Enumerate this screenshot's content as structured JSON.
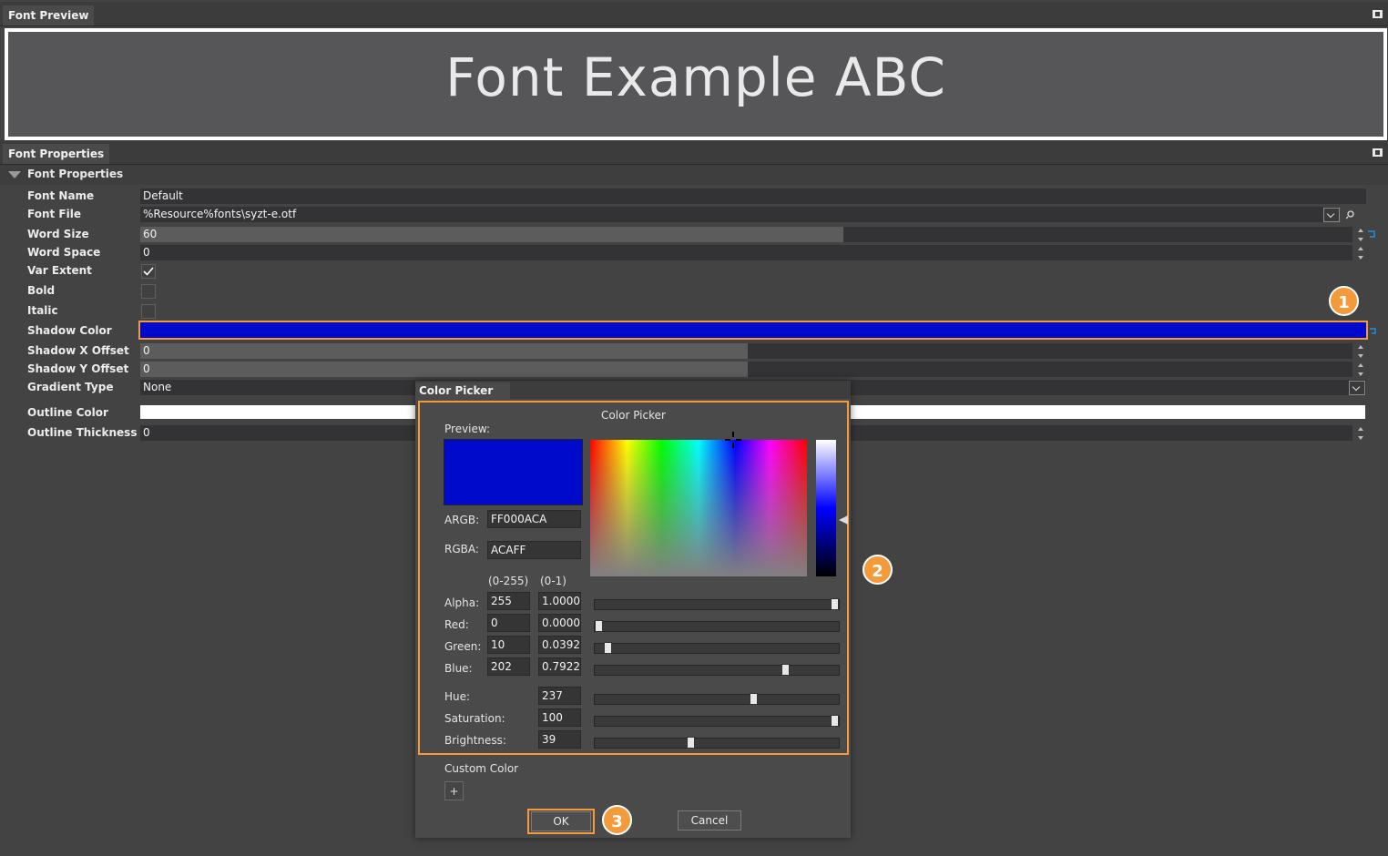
{
  "preview_panel": {
    "title": "Font Preview",
    "sample_text": "Font Example ABC"
  },
  "properties_panel": {
    "title": "Font Properties",
    "section_title": "Font Properties",
    "rows": {
      "font_name": {
        "label": "Font Name",
        "value": "Default"
      },
      "font_file": {
        "label": "Font File",
        "value": "%Resource%fonts\\syzt-e.otf"
      },
      "word_size": {
        "label": "Word Size",
        "value": "60"
      },
      "word_space": {
        "label": "Word Space",
        "value": "0"
      },
      "var_extent": {
        "label": "Var Extent",
        "checked": true
      },
      "bold": {
        "label": "Bold",
        "checked": false
      },
      "italic": {
        "label": "Italic",
        "checked": false
      },
      "shadow_color": {
        "label": "Shadow Color",
        "color": "#000ACA"
      },
      "shadow_x_offset": {
        "label": "Shadow X Offset",
        "value": "0"
      },
      "shadow_y_offset": {
        "label": "Shadow Y Offset",
        "value": "0"
      },
      "gradient_type": {
        "label": "Gradient Type",
        "value": "None"
      },
      "outline_color": {
        "label": "Outline Color",
        "color": "#FFFFFF"
      },
      "outline_thickness": {
        "label": "Outline Thickness",
        "value": "0"
      }
    }
  },
  "color_picker": {
    "window_title": "Color Picker",
    "heading": "Color Picker",
    "preview_label": "Preview:",
    "preview_color": "#000ACA",
    "argb_label": "ARGB:",
    "argb_value": "FF000ACA",
    "rgba_label": "RGBA:",
    "rgba_value": "ACAFF",
    "range_255_label": "(0-255)",
    "range_01_label": "(0-1)",
    "channels": {
      "alpha": {
        "label": "Alpha:",
        "v255": "255",
        "v01": "1.0000",
        "fraction": 1.0
      },
      "red": {
        "label": "Red:",
        "v255": "0",
        "v01": "0.0000",
        "fraction": 0.0
      },
      "green": {
        "label": "Green:",
        "v255": "10",
        "v01": "0.0392",
        "fraction": 0.0392
      },
      "blue": {
        "label": "Blue:",
        "v255": "202",
        "v01": "0.7922",
        "fraction": 0.7922
      }
    },
    "hsb": {
      "hue": {
        "label": "Hue:",
        "value": "237",
        "fraction": 0.658
      },
      "saturation": {
        "label": "Saturation:",
        "value": "100",
        "fraction": 1.0
      },
      "brightness": {
        "label": "Brightness:",
        "value": "39",
        "fraction": 0.39
      }
    },
    "custom_color_label": "Custom Color",
    "add_custom_label": "+",
    "ok_label": "OK",
    "cancel_label": "Cancel"
  },
  "callouts": {
    "one": "1",
    "two": "2",
    "three": "3"
  },
  "colors": {
    "accent": "#F39A3A",
    "highlight": "#1E8FE0"
  }
}
